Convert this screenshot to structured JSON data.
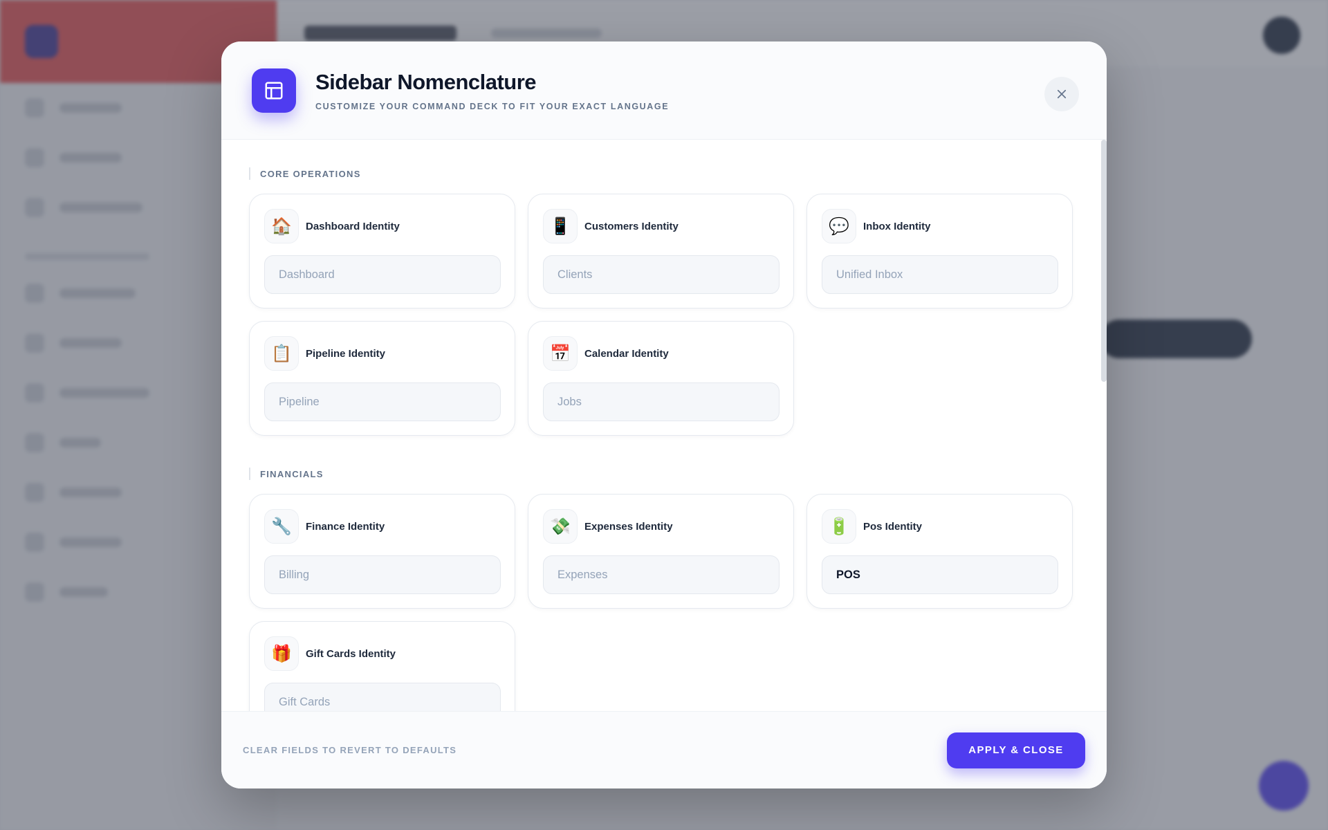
{
  "modal": {
    "title": "Sidebar Nomenclature",
    "subtitle": "Customize your command deck to fit your exact language",
    "close_icon": "close-icon",
    "header_icon": "layout-icon"
  },
  "sections": [
    {
      "label": "Core Operations",
      "cards": [
        {
          "icon": "🏠",
          "icon_name": "house-icon",
          "label": "Dashboard Identity",
          "value": "",
          "placeholder": "Dashboard"
        },
        {
          "icon": "📱",
          "icon_name": "phone-icon",
          "label": "Customers Identity",
          "value": "",
          "placeholder": "Clients"
        },
        {
          "icon": "💬",
          "icon_name": "speech-bubble-icon",
          "label": "Inbox Identity",
          "value": "",
          "placeholder": "Unified Inbox"
        },
        {
          "icon": "📋",
          "icon_name": "clipboard-icon",
          "label": "Pipeline Identity",
          "value": "",
          "placeholder": "Pipeline"
        },
        {
          "icon": "📅",
          "icon_name": "calendar-icon",
          "label": "Calendar Identity",
          "value": "",
          "placeholder": "Jobs"
        }
      ]
    },
    {
      "label": "Financials",
      "cards": [
        {
          "icon": "🔧",
          "icon_name": "wrench-icon",
          "label": "Finance Identity",
          "value": "",
          "placeholder": "Billing"
        },
        {
          "icon": "💸",
          "icon_name": "money-with-wings-icon",
          "label": "Expenses Identity",
          "value": "",
          "placeholder": "Expenses"
        },
        {
          "icon": "🔋",
          "icon_name": "battery-icon",
          "label": "Pos Identity",
          "value": "POS",
          "placeholder": "POS"
        },
        {
          "icon": "🎁",
          "icon_name": "gift-icon",
          "label": "Gift Cards Identity",
          "value": "",
          "placeholder": "Gift Cards"
        }
      ]
    }
  ],
  "footer": {
    "hint": "Clear fields to revert to defaults",
    "apply_label": "Apply & Close"
  },
  "colors": {
    "accent": "#4f3cf0",
    "brand_red": "#e74c4c"
  }
}
